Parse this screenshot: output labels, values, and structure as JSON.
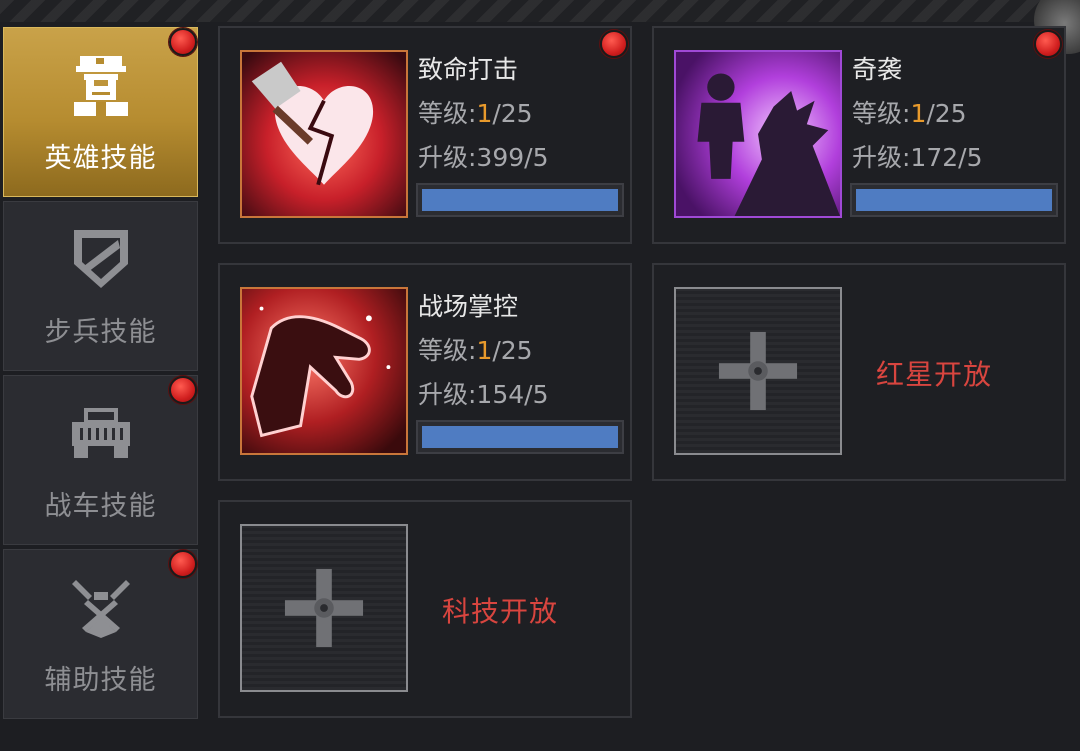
{
  "sidebar": {
    "tabs": [
      {
        "label": "英雄技能",
        "icon": "soldier-head-icon",
        "active": true,
        "badge": true
      },
      {
        "label": "步兵技能",
        "icon": "shield-icon",
        "active": false,
        "badge": false
      },
      {
        "label": "战车技能",
        "icon": "jeep-icon",
        "active": false,
        "badge": true
      },
      {
        "label": "辅助技能",
        "icon": "crossed-tools-icon",
        "active": false,
        "badge": true
      }
    ]
  },
  "skills": [
    {
      "name": "致命打击",
      "level_label": "等级:",
      "level_current": "1",
      "level_max": "/25",
      "upgrade": "升级:399/5",
      "progress": 1.0,
      "badge": true,
      "icon": "broken-heart-cleaver-icon"
    },
    {
      "name": "奇袭",
      "level_label": "等级:",
      "level_current": "1",
      "level_max": "/25",
      "upgrade": "升级:172/5",
      "progress": 1.0,
      "badge": true,
      "icon": "shadow-warriors-icon"
    },
    {
      "name": "战场掌控",
      "level_label": "等级:",
      "level_current": "1",
      "level_max": "/25",
      "upgrade": "升级:154/5",
      "progress": 1.0,
      "badge": false,
      "icon": "grasping-hand-icon"
    }
  ],
  "locked": [
    {
      "text": "红星开放",
      "icon": "locked-cross-icon"
    },
    {
      "text": "科技开放",
      "icon": "locked-cross-icon"
    }
  ],
  "colors": {
    "accent_gold": "#c9a249",
    "badge_red": "#d11f1f",
    "progress_blue": "#4f7cc2",
    "locked_text": "#d8453f",
    "level_orange": "#e89a2c"
  }
}
